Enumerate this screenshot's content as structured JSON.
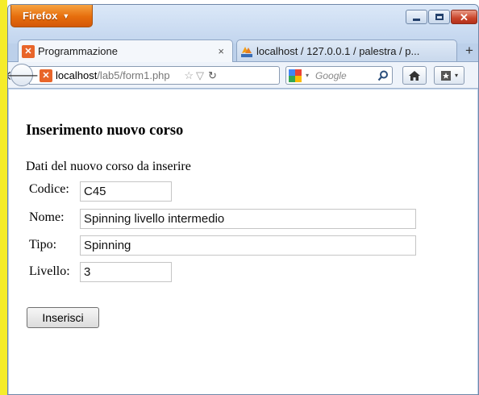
{
  "browser": {
    "app_button": "Firefox",
    "tabs": [
      {
        "title": "Programmazione",
        "close": "×"
      },
      {
        "title": "localhost / 127.0.0.1 / palestra / p..."
      }
    ],
    "new_tab": "+",
    "url_host": "localhost",
    "url_path": "/lab5/form1.php",
    "search_placeholder": "Google",
    "accent_color": "#e66d0c"
  },
  "page": {
    "heading": "Inserimento nuovo corso",
    "section_label": "Dati del nuovo corso da inserire",
    "fields": [
      {
        "label": "Codice:",
        "value": "C45"
      },
      {
        "label": "Nome:",
        "value": "Spinning livello intermedio"
      },
      {
        "label": "Tipo:",
        "value": "Spinning"
      },
      {
        "label": "Livello:",
        "value": "3"
      }
    ],
    "submit_label": "Inserisci"
  }
}
